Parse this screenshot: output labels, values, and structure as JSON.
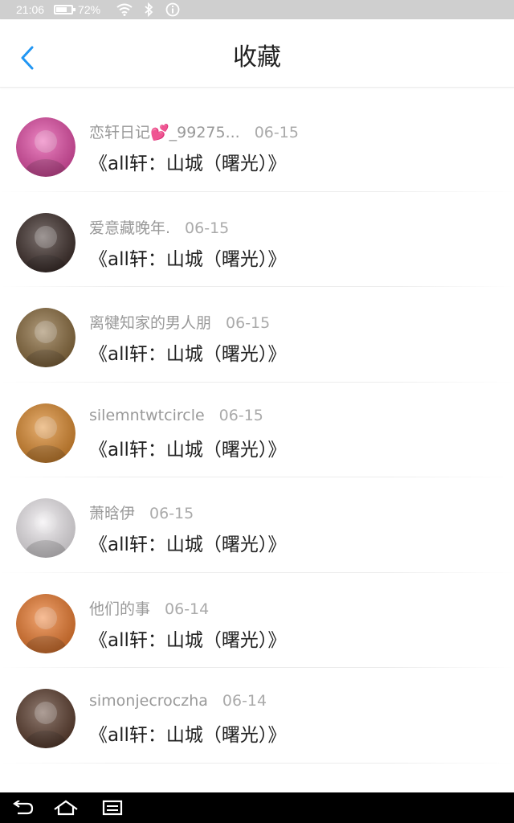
{
  "status_bar": {
    "time": "21:06",
    "battery_percent": "72%",
    "battery_level": 0.72,
    "icons": [
      "wifi-icon",
      "bluetooth-icon",
      "info-icon"
    ]
  },
  "header": {
    "back_icon": "chevron-left-icon",
    "title": "收藏",
    "accent_color": "#2196f3"
  },
  "favorites": [
    {
      "author": "恋轩日记💕_99275...",
      "date": "06-15",
      "title": "《all轩：山城（曙光）》",
      "avatar_color": "#e84aa8"
    },
    {
      "author": "爱意藏晚年.",
      "date": "06-15",
      "title": "《all轩：山城（曙光）》",
      "avatar_color": "#3a2a26"
    },
    {
      "author": "离犍知家的男人朋",
      "date": "06-15",
      "title": "《all轩：山城（曙光）》",
      "avatar_color": "#8a6a3a"
    },
    {
      "author": "silemntwtcircle",
      "date": "06-15",
      "title": "《all轩：山城（曙光）》",
      "avatar_color": "#e08a2a"
    },
    {
      "author": "萧晗伊",
      "date": "06-15",
      "title": "《all轩：山城（曙光）》",
      "avatar_color": "#f2eef2"
    },
    {
      "author": "他们的事",
      "date": "06-14",
      "title": "《all轩：山城（曙光）》",
      "avatar_color": "#f07a2a"
    },
    {
      "author": "simonjecroczha",
      "date": "06-14",
      "title": "《all轩：山城（曙光）》",
      "avatar_color": "#5a3a2a"
    }
  ],
  "nav_bar": {
    "icons": [
      "back-nav-icon",
      "home-icon",
      "recent-apps-icon"
    ]
  }
}
